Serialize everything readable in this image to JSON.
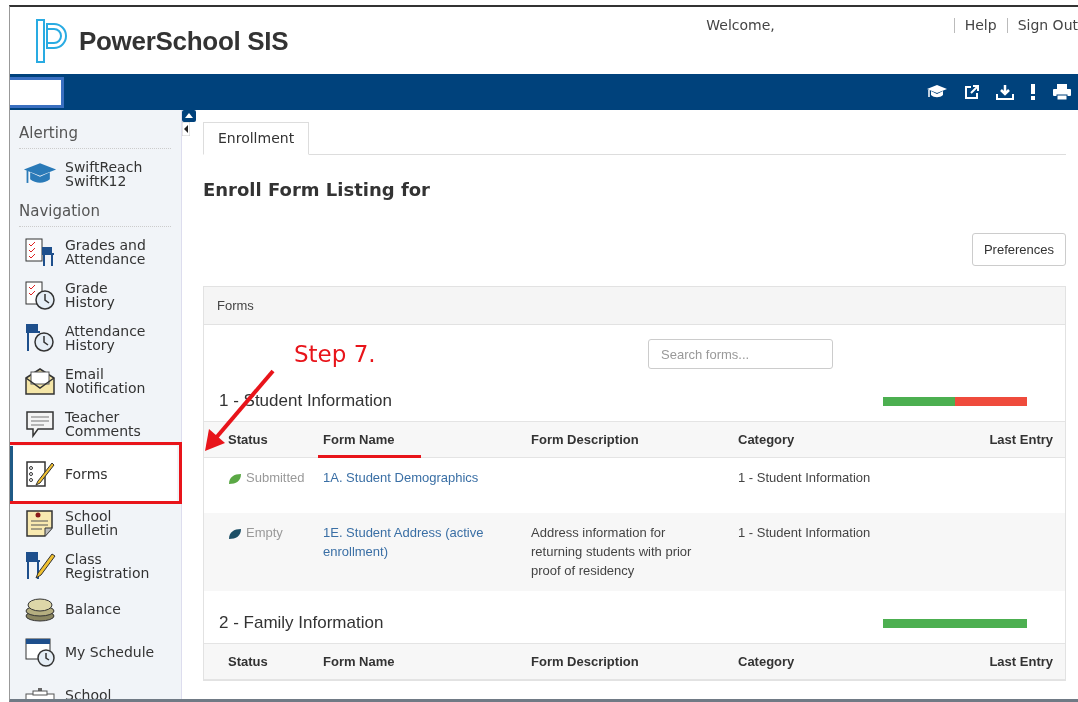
{
  "header": {
    "logo_text": "PowerSchool SIS",
    "welcome": "Welcome,",
    "links": [
      "Help",
      "Sign Out"
    ]
  },
  "sidebar": {
    "sections": [
      {
        "heading": "Alerting",
        "items": [
          {
            "label": "SwiftReach\nSwiftK12",
            "selected": false
          }
        ]
      },
      {
        "heading": "Navigation",
        "items": [
          {
            "label": "Grades and\nAttendance",
            "selected": false
          },
          {
            "label": "Grade\nHistory",
            "selected": false
          },
          {
            "label": "Attendance\nHistory",
            "selected": false
          },
          {
            "label": "Email\nNotification",
            "selected": false
          },
          {
            "label": "Teacher\nComments",
            "selected": false
          },
          {
            "label": "Forms",
            "selected": true,
            "annotated": true
          },
          {
            "label": "School\nBulletin",
            "selected": false
          },
          {
            "label": "Class\nRegistration",
            "selected": false
          },
          {
            "label": "Balance",
            "selected": false
          },
          {
            "label": "My Schedule",
            "selected": false
          },
          {
            "label": "School",
            "selected": false
          }
        ]
      }
    ]
  },
  "tabs": [
    {
      "label": "Enrollment",
      "selected": true
    }
  ],
  "page_title": "Enroll Form Listing for",
  "preferences_button": "Preferences",
  "forms_panel": {
    "title": "Forms",
    "search": {
      "placeholder": "Search forms..."
    },
    "sections": [
      {
        "title": "1 - Student Information",
        "level": 0.5,
        "columns": [
          {
            "label": "Status"
          },
          {
            "label": "Form Name",
            "annotated": true
          },
          {
            "label": "Form Description"
          },
          {
            "label": "Category"
          },
          {
            "label": "Last Entry"
          }
        ],
        "rows": [
          {
            "status": "Submitted",
            "color": "#5aa845",
            "form_name": "1A. Student Demographics",
            "category": "1 - Student Information"
          },
          {
            "status": "Empty",
            "color": "#1c4f66",
            "form_name": "1E. Student Address (active enrollment)",
            "description": "Address information for returning students with prior proof of residency",
            "category": "1 - Student Information"
          }
        ]
      },
      {
        "title": "2 - Family Information",
        "level": 1,
        "columns": [
          {
            "label": "Status"
          },
          {
            "label": "Form Name"
          },
          {
            "label": "Form Description"
          },
          {
            "label": "Category"
          },
          {
            "label": "Last Entry"
          }
        ]
      }
    ]
  },
  "annotation": {
    "text": "Step 7."
  }
}
